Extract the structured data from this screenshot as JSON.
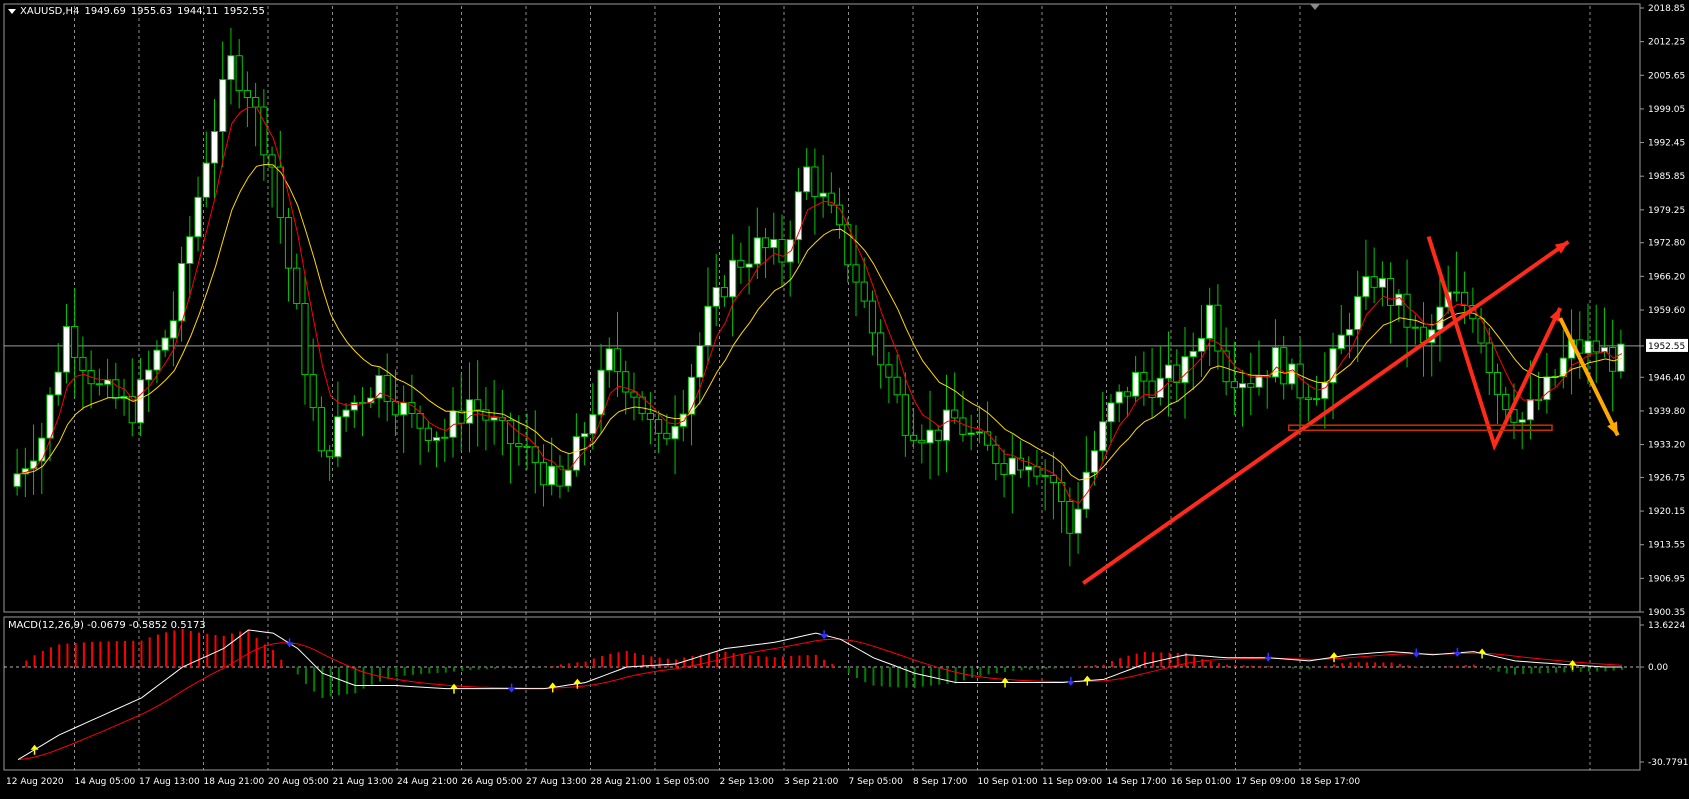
{
  "window": {
    "symbol": "XAUUSD,H4",
    "ohlc": [
      "1949.69",
      "1955.63",
      "1944.11",
      "1952.55"
    ],
    "indicator_label": "MACD(12,26,9) -0.0679 -0.5852 0.5173"
  },
  "colors": {
    "background": "#000000",
    "grid": "#ffffff",
    "bull_candle": "#ffffff",
    "candle_outline": "#00c800",
    "ma_fast": "#ff0000",
    "ma_slow": "#ffd700",
    "trend_arrow": "#ff2a1a",
    "forecast_arrow": "#ffaa00",
    "support_box": "#c83200",
    "macd_pos": "#ff0000",
    "macd_neg": "#008000",
    "macd_line": "#ffffff",
    "signal_line": "#ff0000",
    "buy_marker": "#ffff00",
    "sell_marker": "#3333ff"
  },
  "chart_data": {
    "type": "candlestick",
    "price_axis": {
      "min": 1900.35,
      "max": 2018.85,
      "ticks": [
        "2018.85",
        "2012.25",
        "2005.65",
        "1999.05",
        "1992.45",
        "1985.85",
        "1979.25",
        "1972.80",
        "1966.20",
        "1959.60",
        "1952.55",
        "1946.40",
        "1939.80",
        "1933.20",
        "1926.75",
        "1920.15",
        "1913.55",
        "1906.95",
        "1900.35"
      ],
      "current_price": "1952.55"
    },
    "time_axis": {
      "labels": [
        "12 Aug 2020",
        "14 Aug 05:00",
        "17 Aug 13:00",
        "18 Aug 21:00",
        "20 Aug 05:00",
        "21 Aug 13:00",
        "24 Aug 21:00",
        "26 Aug 05:00",
        "27 Aug 13:00",
        "28 Aug 21:00",
        "1 Sep 05:00",
        "2 Sep 13:00",
        "3 Sep 21:00",
        "7 Sep 05:00",
        "8 Sep 17:00",
        "10 Sep 01:00",
        "11 Sep 09:00",
        "14 Sep 17:00",
        "16 Sep 01:00",
        "17 Sep 09:00",
        "18 Sep 17:00"
      ]
    },
    "price_path": [
      [
        0,
        1925
      ],
      [
        4,
        1935
      ],
      [
        7,
        1956
      ],
      [
        11,
        1944
      ],
      [
        15,
        1940
      ],
      [
        20,
        1958
      ],
      [
        24,
        1990
      ],
      [
        27,
        2008
      ],
      [
        29,
        2003
      ],
      [
        32,
        1988
      ],
      [
        34,
        1968
      ],
      [
        38,
        1930
      ],
      [
        41,
        1940
      ],
      [
        45,
        1946
      ],
      [
        49,
        1938
      ],
      [
        53,
        1935
      ],
      [
        56,
        1942
      ],
      [
        60,
        1935
      ],
      [
        64,
        1930
      ],
      [
        67,
        1924
      ],
      [
        70,
        1936
      ],
      [
        73,
        1950
      ],
      [
        76,
        1944
      ],
      [
        79,
        1933
      ],
      [
        82,
        1942
      ],
      [
        85,
        1958
      ],
      [
        88,
        1968
      ],
      [
        91,
        1972
      ],
      [
        94,
        1970
      ],
      [
        97,
        1987
      ],
      [
        100,
        1978
      ],
      [
        103,
        1966
      ],
      [
        106,
        1950
      ],
      [
        109,
        1938
      ],
      [
        112,
        1935
      ],
      [
        115,
        1938
      ],
      [
        118,
        1933
      ],
      [
        121,
        1930
      ],
      [
        124,
        1931
      ],
      [
        127,
        1926
      ],
      [
        129,
        1916
      ],
      [
        131,
        1928
      ],
      [
        134,
        1940
      ],
      [
        137,
        1946
      ],
      [
        140,
        1945
      ],
      [
        143,
        1948
      ],
      [
        146,
        1960
      ],
      [
        148,
        1948
      ],
      [
        151,
        1946
      ],
      [
        154,
        1950
      ],
      [
        157,
        1944
      ],
      [
        160,
        1945
      ],
      [
        163,
        1958
      ],
      [
        166,
        1966
      ],
      [
        169,
        1960
      ],
      [
        172,
        1952
      ],
      [
        175,
        1962
      ],
      [
        178,
        1960
      ],
      [
        181,
        1944
      ],
      [
        184,
        1938
      ],
      [
        187,
        1944
      ],
      [
        190,
        1952
      ],
      [
        193,
        1952
      ],
      [
        195,
        1950
      ]
    ],
    "macd_axis": {
      "min": -30.7791,
      "max": 13.6224,
      "ticks": [
        "13.6224",
        "0.00",
        "-30.7791"
      ]
    },
    "macd_path": [
      [
        0,
        -30
      ],
      [
        5,
        -22
      ],
      [
        10,
        -16
      ],
      [
        15,
        -10
      ],
      [
        20,
        0
      ],
      [
        25,
        6
      ],
      [
        28,
        12
      ],
      [
        31,
        11
      ],
      [
        34,
        6
      ],
      [
        37,
        -2
      ],
      [
        41,
        -6
      ],
      [
        46,
        -6
      ],
      [
        52,
        -7
      ],
      [
        58,
        -7
      ],
      [
        64,
        -7
      ],
      [
        69,
        -5
      ],
      [
        74,
        0
      ],
      [
        80,
        1
      ],
      [
        86,
        6
      ],
      [
        92,
        8
      ],
      [
        97,
        11
      ],
      [
        100,
        9
      ],
      [
        104,
        3
      ],
      [
        109,
        -2
      ],
      [
        114,
        -5
      ],
      [
        120,
        -5
      ],
      [
        127,
        -5
      ],
      [
        132,
        -4
      ],
      [
        137,
        1
      ],
      [
        142,
        4
      ],
      [
        147,
        3
      ],
      [
        152,
        3
      ],
      [
        157,
        2
      ],
      [
        162,
        4
      ],
      [
        167,
        5
      ],
      [
        172,
        4
      ],
      [
        177,
        5
      ],
      [
        182,
        2
      ],
      [
        187,
        1
      ],
      [
        193,
        0
      ],
      [
        195,
        0
      ]
    ],
    "buy_markers": [
      2,
      53,
      65,
      68,
      120,
      130,
      160,
      178,
      189
    ],
    "sell_markers": [
      33,
      60,
      98,
      128,
      152,
      170,
      175
    ],
    "annotations": [
      {
        "kind": "arrow",
        "from": [
          130,
          1906
        ],
        "to": [
          189,
          1973
        ],
        "role": "trend"
      },
      {
        "kind": "polyline",
        "points": [
          [
            172,
            1974
          ],
          [
            180,
            1933
          ],
          [
            188,
            1960
          ]
        ],
        "role": "trend"
      },
      {
        "kind": "arrow",
        "from": [
          188,
          1958
        ],
        "to": [
          195,
          1935
        ],
        "role": "forecast"
      },
      {
        "kind": "box",
        "from": [
          155,
          1937
        ],
        "to": [
          187,
          1936
        ],
        "role": "support"
      }
    ]
  }
}
